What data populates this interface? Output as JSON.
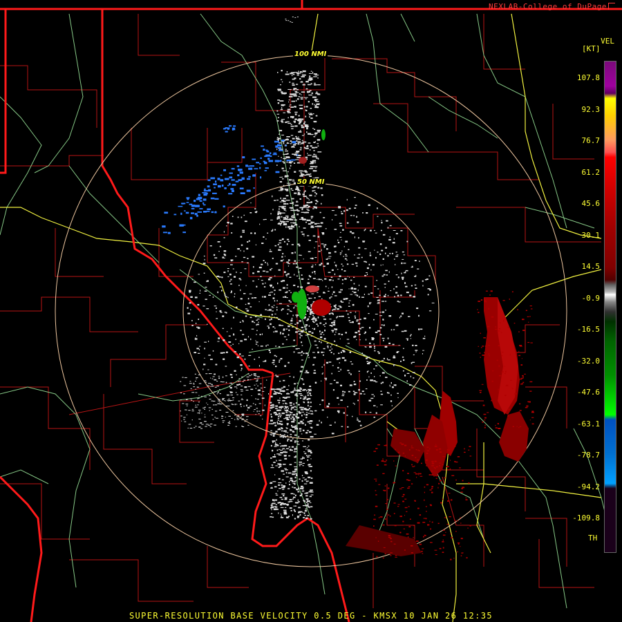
{
  "credit": "NEXLAB-College of DuPage",
  "caption": "SUPER-RESOLUTION BASE VELOCITY 0.5 DEG - KMSX 10 JAN 26 12:35",
  "rings": [
    {
      "label": "100 NMI"
    },
    {
      "label": "50 NMI"
    }
  ],
  "legend": {
    "product": "VEL",
    "unit": "[KT]",
    "labels": [
      "107.8",
      "92.3",
      "76.7",
      "61.2",
      "45.6",
      "30.1",
      "14.5",
      "-0.9",
      "-16.5",
      "-32.0",
      "-47.6",
      "-63.1",
      "-78.7",
      "-94.2",
      "-109.8"
    ],
    "th_label": "TH"
  },
  "colors": {
    "state_border": "#ff1a1a",
    "county_line": "#c01818",
    "river_line": "#90d090",
    "highway_line": "#ffff40",
    "range_ring": "#f0c8a0",
    "label_text": "#ffff33",
    "outbound": "#c00000",
    "inbound": "#00c000",
    "near_zero": "#e8e8e8",
    "blue": "#2a7bff"
  },
  "icons": {
    "credit_icon": "corner-arrow-icon"
  }
}
